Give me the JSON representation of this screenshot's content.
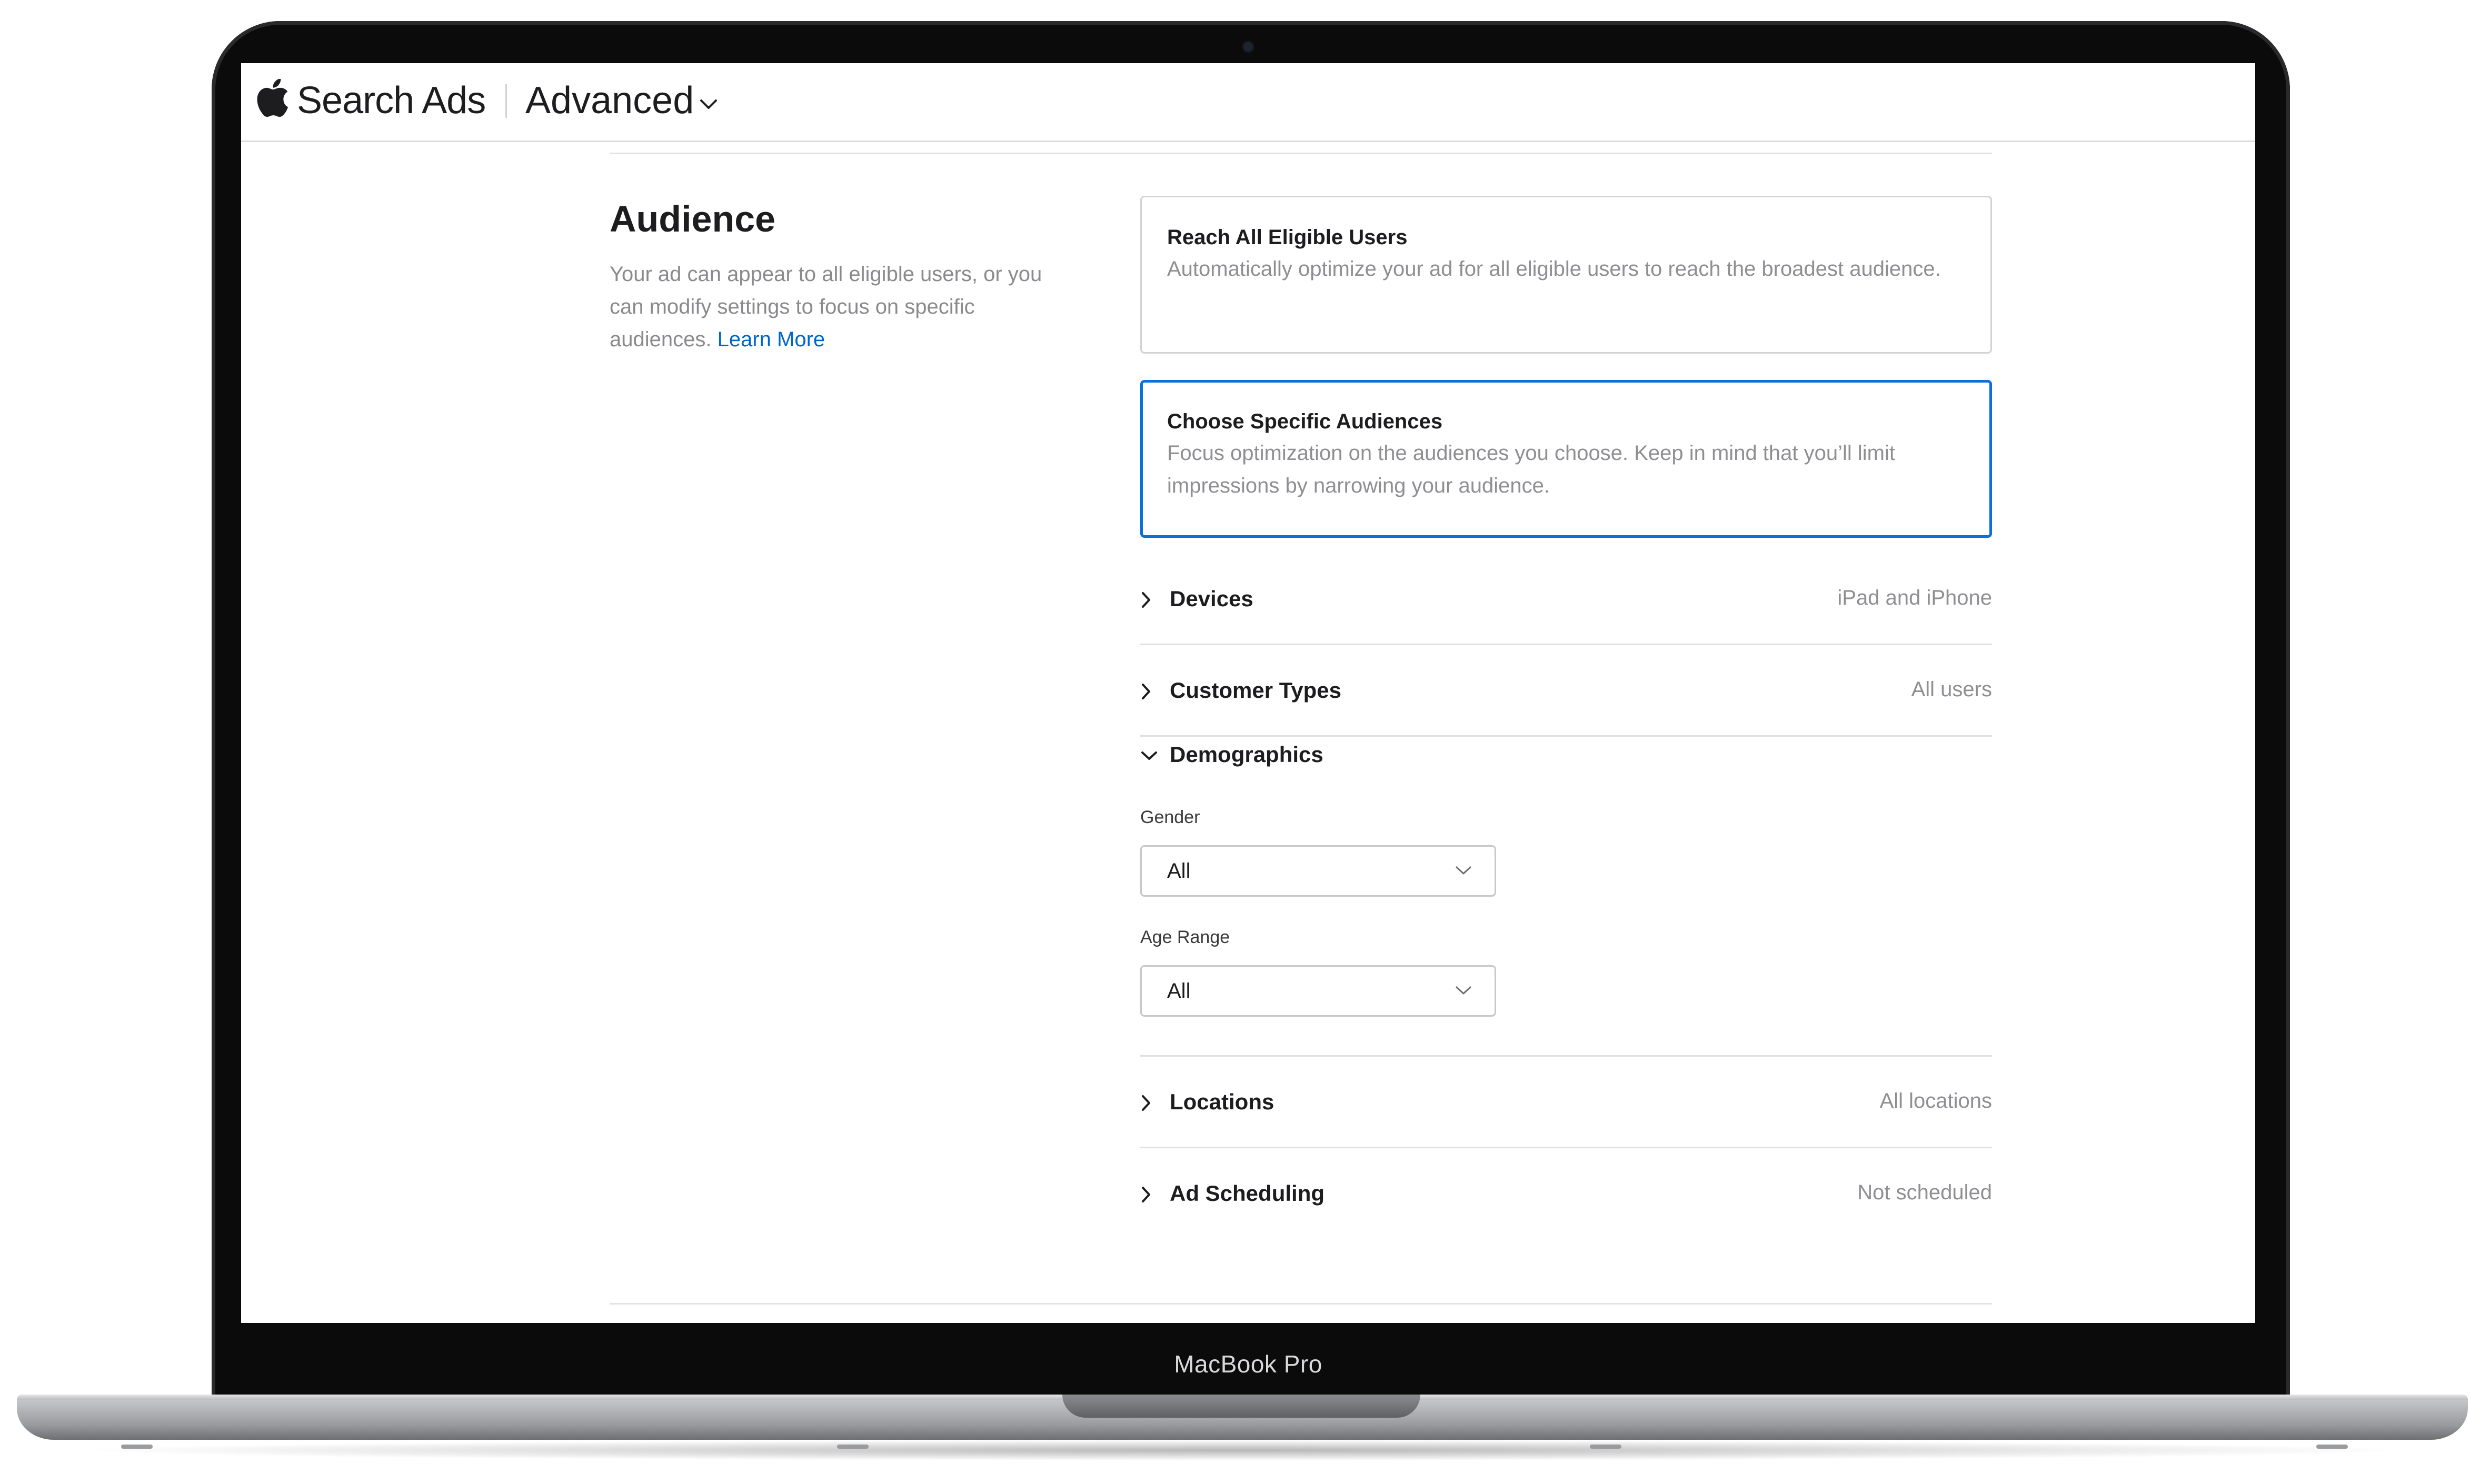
{
  "header": {
    "brand": "Search Ads",
    "mode": "Advanced"
  },
  "audience": {
    "title": "Audience",
    "description": "Your ad can appear to all eligible users, or you can modify settings to focus on specific audiences.",
    "learn_more": "Learn More"
  },
  "options": [
    {
      "title": "Reach All Eligible Users",
      "description": "Automatically optimize your ad for all eligible users to reach the broadest audience.",
      "selected": false
    },
    {
      "title": "Choose Specific Audiences",
      "description": "Focus optimization on the audiences you choose. Keep in mind that you’ll limit impressions by narrowing your audience.",
      "selected": true
    }
  ],
  "rows": {
    "devices": {
      "label": "Devices",
      "value": "iPad and iPhone"
    },
    "customer_types": {
      "label": "Customer Types",
      "value": "All users"
    },
    "demographics": {
      "label": "Demographics"
    },
    "locations": {
      "label": "Locations",
      "value": "All locations"
    },
    "ad_scheduling": {
      "label": "Ad Scheduling",
      "value": "Not scheduled"
    }
  },
  "demographics": {
    "gender": {
      "label": "Gender",
      "value": "All"
    },
    "age_range": {
      "label": "Age Range",
      "value": "All"
    }
  },
  "device": {
    "model": "MacBook Pro"
  },
  "colors": {
    "accent": "#0a6fd8",
    "link": "#0066cc",
    "secondary_text": "#8e8e93"
  },
  "icons": {
    "brand": "apple-logo-icon",
    "collapsed": "chevron-right-icon",
    "expanded": "chevron-down-icon"
  }
}
